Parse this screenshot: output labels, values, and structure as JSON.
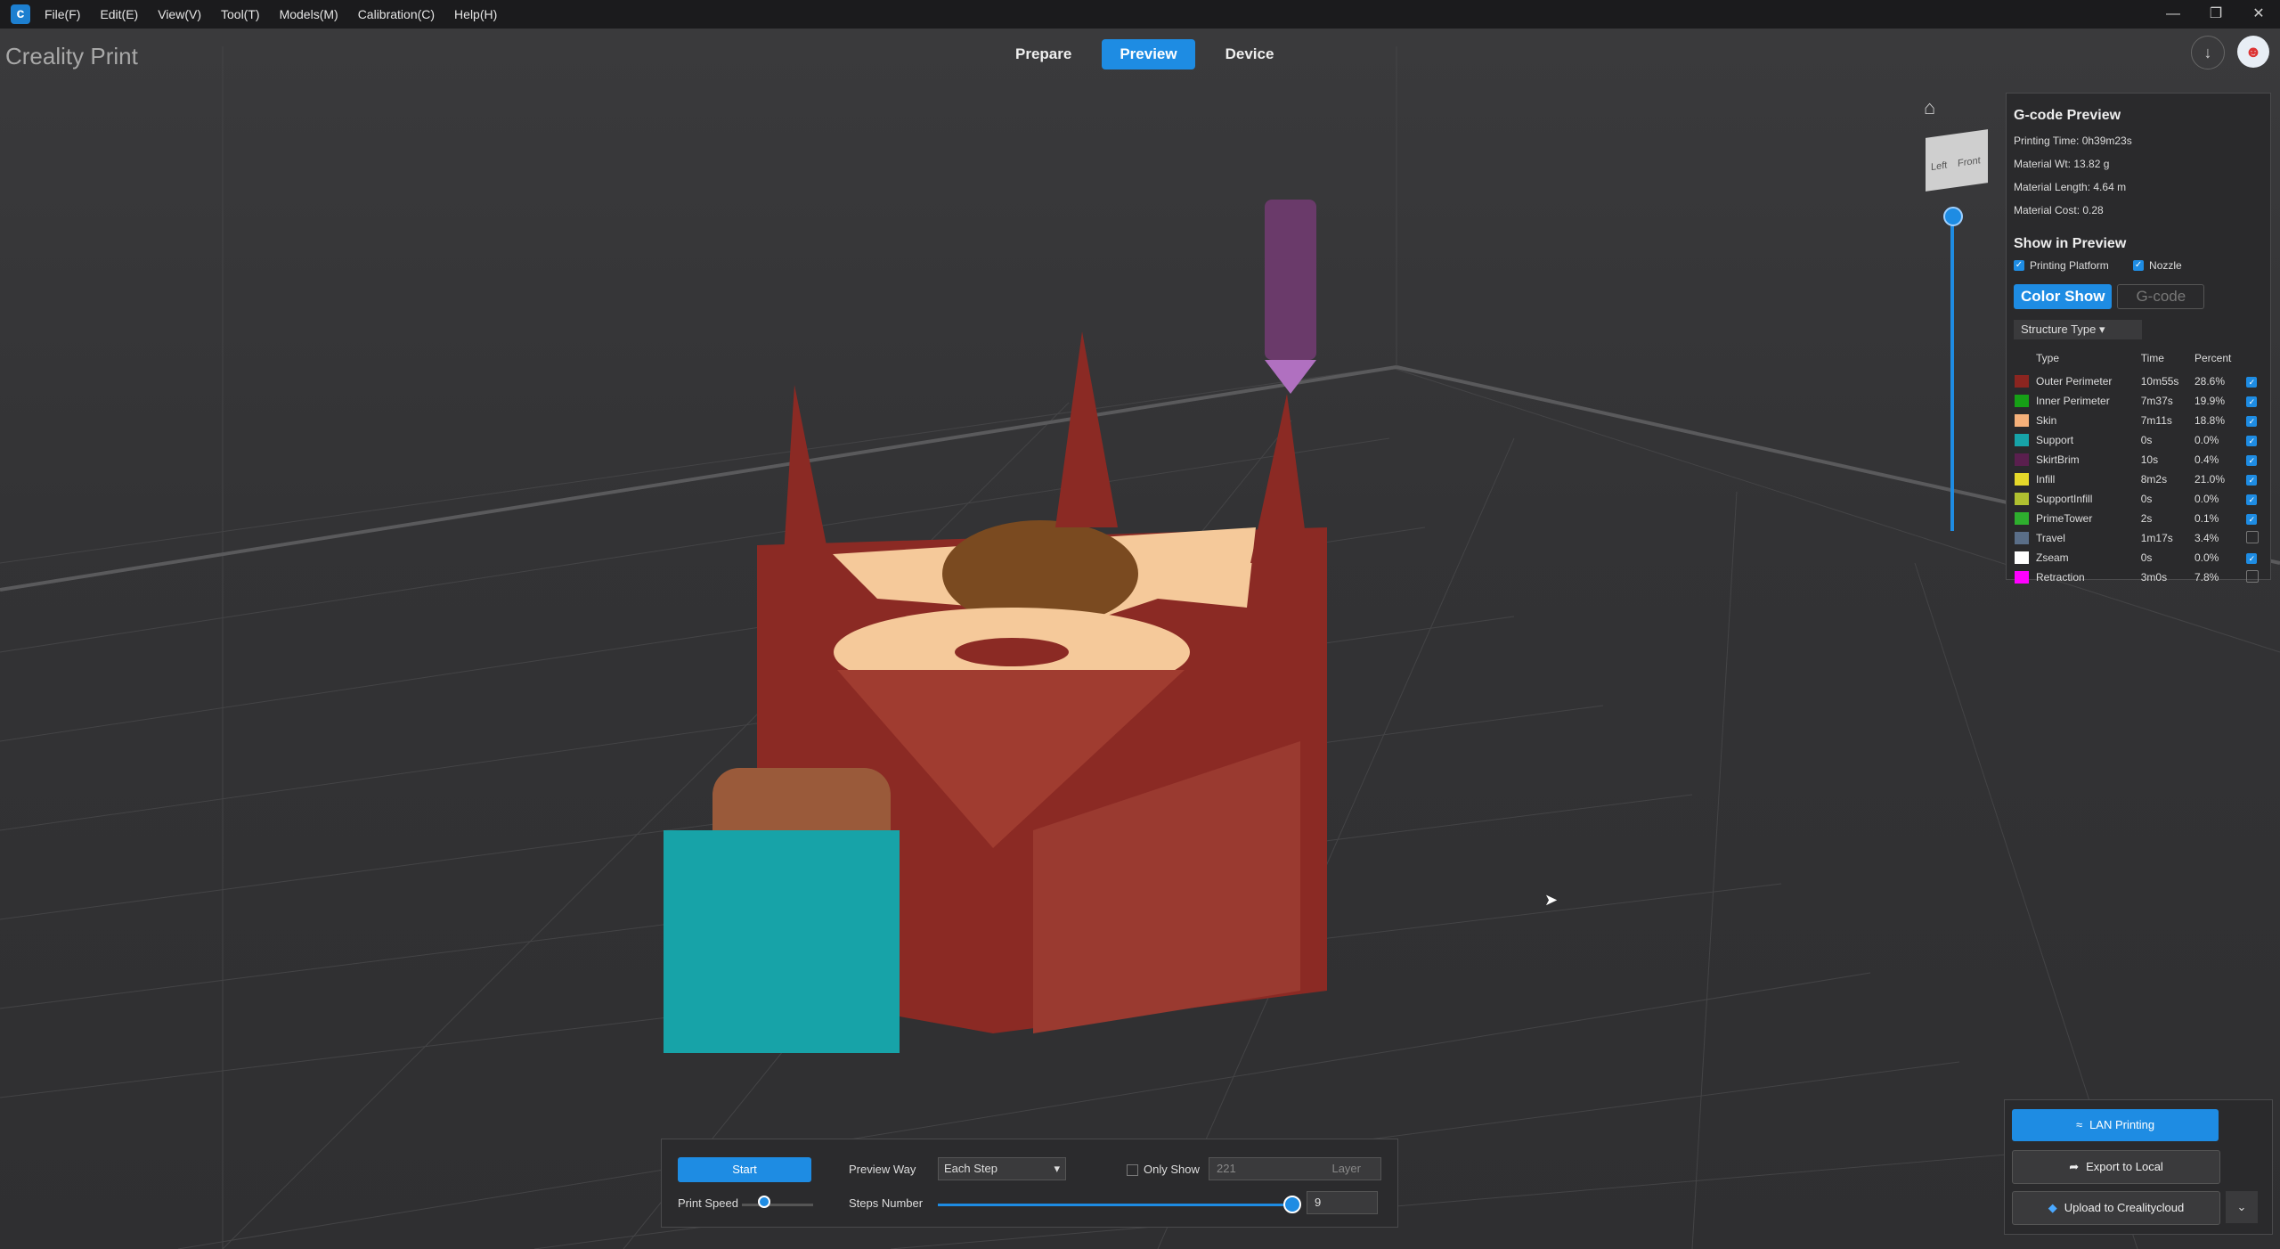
{
  "menubar": {
    "items": [
      "File(F)",
      "Edit(E)",
      "View(V)",
      "Tool(T)",
      "Models(M)",
      "Calibration(C)",
      "Help(H)"
    ]
  },
  "app_title": "Creality Print",
  "tabs": [
    {
      "label": "Prepare",
      "active": false
    },
    {
      "label": "Preview",
      "active": true
    },
    {
      "label": "Device",
      "active": false
    }
  ],
  "viewcube": {
    "left_label": "Left",
    "front_label": "Front"
  },
  "gcode_preview": {
    "title": "G-code Preview",
    "printing_time": "Printing Time: 0h39m23s",
    "material_wt": "Material Wt: 13.82 g",
    "material_length": "Material Length: 4.64 m",
    "material_cost": "Material Cost: 0.28",
    "show_title": "Show in Preview",
    "printing_platform": "Printing Platform",
    "nozzle": "Nozzle",
    "color_show": "Color Show",
    "gcode": "G-code",
    "structure_type": "Structure Type",
    "headers": {
      "type": "Type",
      "time": "Time",
      "percent": "Percent"
    },
    "rows": [
      {
        "color": "#8b2520",
        "type": "Outer Perimeter",
        "time": "10m55s",
        "percent": "28.6%",
        "checked": true
      },
      {
        "color": "#16a016",
        "type": "Inner Perimeter",
        "time": "7m37s",
        "percent": "19.9%",
        "checked": true
      },
      {
        "color": "#f5b07a",
        "type": "Skin",
        "time": "7m11s",
        "percent": "18.8%",
        "checked": true
      },
      {
        "color": "#17a3a8",
        "type": "Support",
        "time": "0s",
        "percent": "0.0%",
        "checked": true
      },
      {
        "color": "#5a1f4e",
        "type": "SkirtBrim",
        "time": "10s",
        "percent": "0.4%",
        "checked": true
      },
      {
        "color": "#e5d82a",
        "type": "Infill",
        "time": "8m2s",
        "percent": "21.0%",
        "checked": true
      },
      {
        "color": "#b0c030",
        "type": "SupportInfill",
        "time": "0s",
        "percent": "0.0%",
        "checked": true
      },
      {
        "color": "#2eae2e",
        "type": "PrimeTower",
        "time": "2s",
        "percent": "0.1%",
        "checked": true
      },
      {
        "color": "#5a6e88",
        "type": "Travel",
        "time": "1m17s",
        "percent": "3.4%",
        "checked": false
      },
      {
        "color": "#ffffff",
        "type": "Zseam",
        "time": "0s",
        "percent": "0.0%",
        "checked": true
      },
      {
        "color": "#ff00ff",
        "type": "Retraction",
        "time": "3m0s",
        "percent": "7.8%",
        "checked": false
      }
    ]
  },
  "bottom_bar": {
    "start": "Start",
    "print_speed": "Print Speed",
    "preview_way_label": "Preview Way",
    "preview_way_value": "Each Step",
    "only_show": "Only Show",
    "layer_value": "221",
    "layer_label": "Layer",
    "steps_number_label": "Steps Number",
    "steps_number_value": "9"
  },
  "export_panel": {
    "lan": "LAN Printing",
    "export": "Export to Local",
    "upload": "Upload to Crealitycloud"
  }
}
